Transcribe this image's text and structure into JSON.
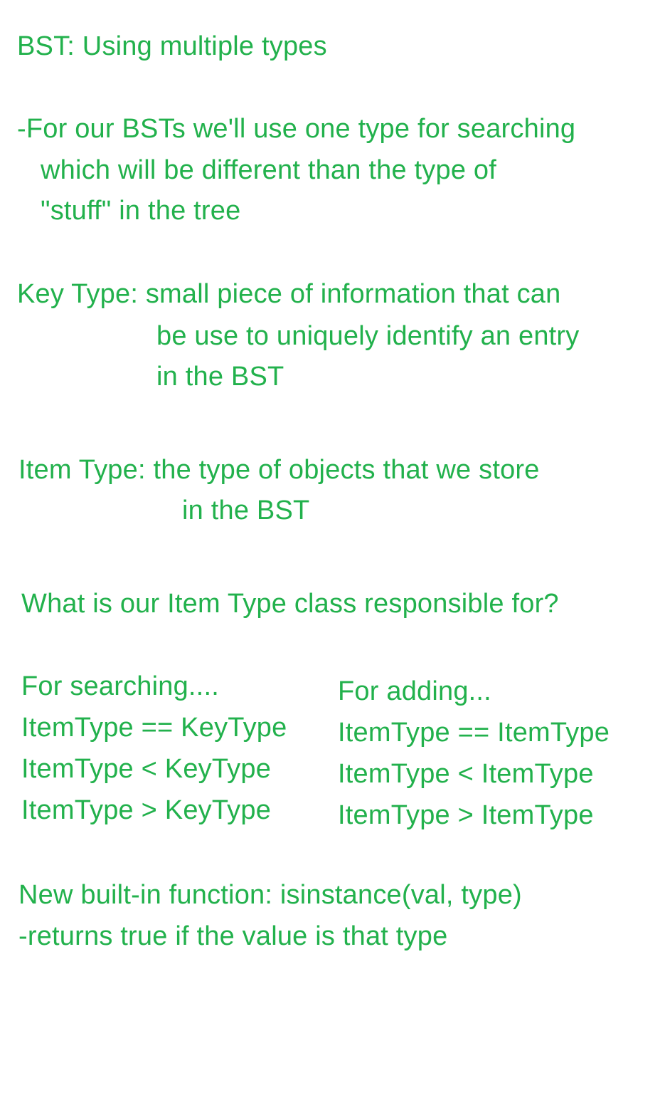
{
  "text_color": "#22b14c",
  "title": "BST: Using multiple types",
  "intro": {
    "line1": "-For our BSTs we'll use one type for searching",
    "line2": "which will be different than the type of",
    "line3": "\"stuff\" in the tree"
  },
  "key_type": {
    "line1": "Key Type: small piece of information that can",
    "line2": "be use to uniquely identify an entry",
    "line3": "in the BST"
  },
  "item_type": {
    "line1": "Item Type: the type of objects that we store",
    "line2": "in the BST"
  },
  "question": "What is our Item Type class responsible for?",
  "searching": {
    "heading": "For searching....",
    "ops": [
      "ItemType == KeyType",
      "ItemType < KeyType",
      "ItemType > KeyType"
    ]
  },
  "adding": {
    "heading": "For adding...",
    "ops": [
      "ItemType == ItemType",
      "ItemType < ItemType",
      "ItemType > ItemType"
    ]
  },
  "builtin": {
    "line1": "New built-in function: isinstance(val, type)",
    "line2": "-returns true if the value is that type"
  }
}
